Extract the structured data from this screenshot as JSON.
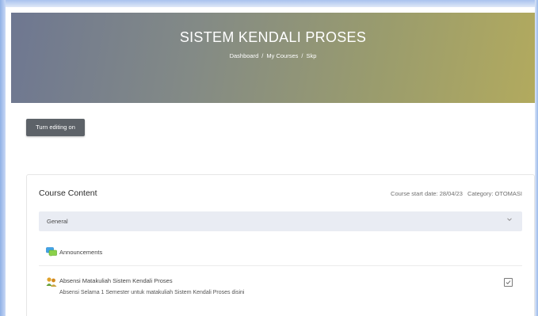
{
  "header": {
    "title": "SISTEM KENDALI PROSES",
    "breadcrumb": {
      "items": [
        "Dashboard",
        "My Courses",
        "Skp"
      ],
      "separator": "/"
    }
  },
  "toolbar": {
    "edit_label": "Turn editing on"
  },
  "course": {
    "title": "Course Content",
    "start_date": "Course start date: 28/04/23",
    "category": "Category: OTOMASI",
    "section": {
      "label": "General",
      "toggle_icon": "chevron-down-icon"
    },
    "activities": [
      {
        "name": "Announcements",
        "icon": "forum-icon"
      },
      {
        "name": "Absensi Matakuliah Sistem Kendali Proses",
        "description": "Absensi Selama 1 Semester untuk matakuliah Sistem Kendali Proses disini",
        "icon": "attendance-icon",
        "completion_icon": "completion-checkbox-icon"
      }
    ]
  },
  "colors": {
    "header_gradient_start": "#6e7791",
    "header_gradient_end": "#b2aa5e",
    "button_bg": "#5d6268",
    "section_bg": "#e9ecf3"
  }
}
